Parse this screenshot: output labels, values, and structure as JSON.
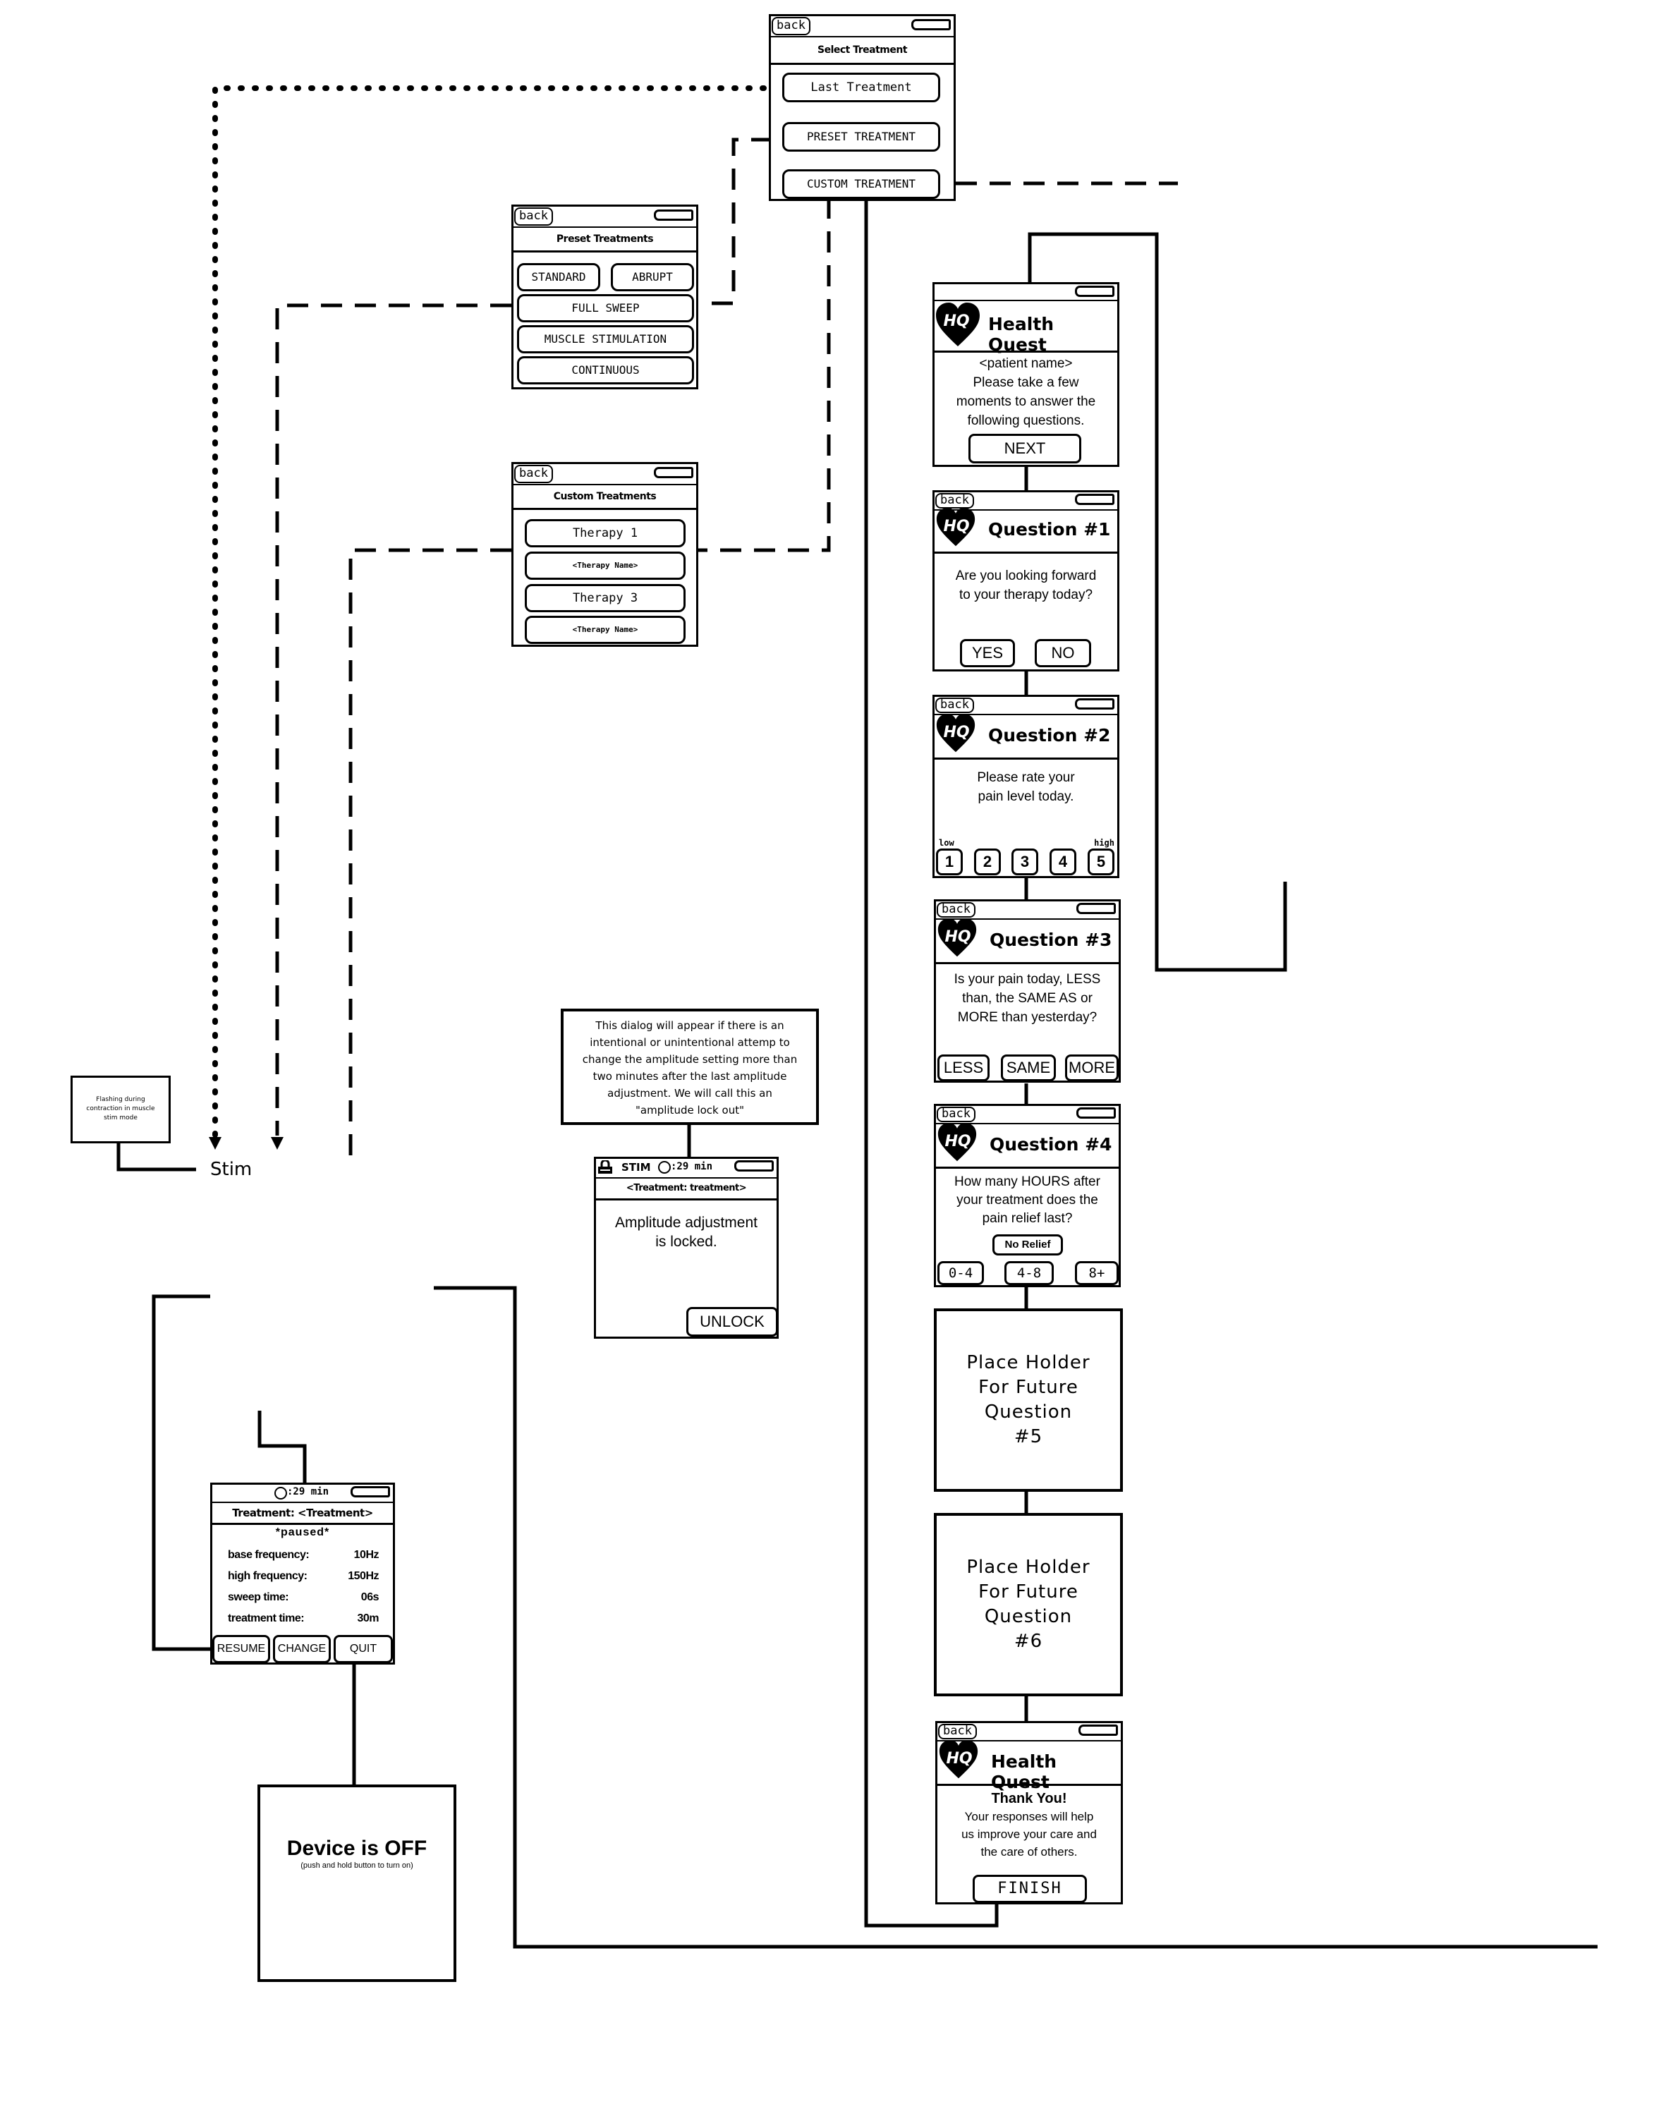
{
  "select_treatment": {
    "back": "back",
    "title": "Select Treatment",
    "buttons": [
      "Last Treatment",
      "PRESET TREATMENT",
      "CUSTOM TREATMENT"
    ]
  },
  "preset_treatments": {
    "back": "back",
    "title": "Preset Treatments",
    "buttons": [
      "STANDARD",
      "ABRUPT",
      "FULL SWEEP",
      "MUSCLE STIMULATION",
      "CONTINUOUS"
    ]
  },
  "custom_treatments": {
    "back": "back",
    "title": "Custom Treatments",
    "buttons": [
      "Therapy 1",
      "<Therapy Name>",
      "Therapy 3",
      "<Therapy Name>"
    ]
  },
  "health_quest_intro": {
    "logo": "HQ",
    "title": "Health Quest",
    "body": [
      "<patient name>",
      "Please take a few",
      "moments to answer the",
      "following questions."
    ],
    "next": "NEXT"
  },
  "question1": {
    "back": "back",
    "logo": "HQ",
    "title": "Question #1",
    "body": [
      "Are you looking forward",
      "to your therapy today?"
    ],
    "answers": [
      "YES",
      "NO"
    ]
  },
  "question2": {
    "back": "back",
    "logo": "HQ",
    "title": "Question #2",
    "body": [
      "Please rate your",
      "pain level today."
    ],
    "low_label": "low",
    "high_label": "high",
    "answers": [
      "1",
      "2",
      "3",
      "4",
      "5"
    ]
  },
  "question3": {
    "back": "back",
    "logo": "HQ",
    "title": "Question #3",
    "body": [
      "Is your pain today, LESS",
      "than, the SAME AS or",
      "MORE than yesterday?"
    ],
    "answers": [
      "LESS",
      "SAME",
      "MORE"
    ]
  },
  "question4": {
    "back": "back",
    "logo": "HQ",
    "title": "Question #4",
    "body": [
      "How many HOURS after",
      "your treatment does the",
      "pain relief last?"
    ],
    "no_relief": "No Relief",
    "answers": [
      "0-4",
      "4-8",
      "8+"
    ]
  },
  "placeholder5": [
    "Place Holder",
    "For Future",
    "Question",
    "#5"
  ],
  "placeholder6": [
    "Place Holder",
    "For Future",
    "Question",
    "#6"
  ],
  "health_quest_thanks": {
    "back": "back",
    "logo": "HQ",
    "title": "Health Quest",
    "heading": "Thank You!",
    "body": [
      "Your responses will help",
      "us improve your care and",
      "the care of others."
    ],
    "finish": "FINISH"
  },
  "lock_note": [
    "This dialog will appear if there is an",
    "intentional or unintentional attemp to",
    "change the amplitude setting more than",
    "two minutes after the last amplitude",
    "adjustment.   We will call this an",
    "\"amplitude lock out\""
  ],
  "amplitude_locked": {
    "mode": "STIM",
    "timer": ":29 min",
    "treatment": "<Treatment: treatment>",
    "message": [
      "Amplitude adjustment",
      "is locked."
    ],
    "unlock": "UNLOCK"
  },
  "paused_screen": {
    "timer": ":29 min",
    "treatment": "Treatment: <Treatment>",
    "status": "*paused*",
    "stats": [
      {
        "label": "base frequency:",
        "value": "10Hz"
      },
      {
        "label": "high frequency:",
        "value": "150Hz"
      },
      {
        "label": "sweep time:",
        "value": "06s"
      },
      {
        "label": "treatment time:",
        "value": "30m"
      }
    ],
    "buttons": [
      "RESUME",
      "CHANGE",
      "QUIT"
    ]
  },
  "device_off": {
    "title": "Device is OFF",
    "subtitle": "(push and hold button to turn on)"
  },
  "flash_note": [
    "Flashing during",
    "contraction in muscle",
    "stim mode"
  ],
  "stim_label": "Stim"
}
